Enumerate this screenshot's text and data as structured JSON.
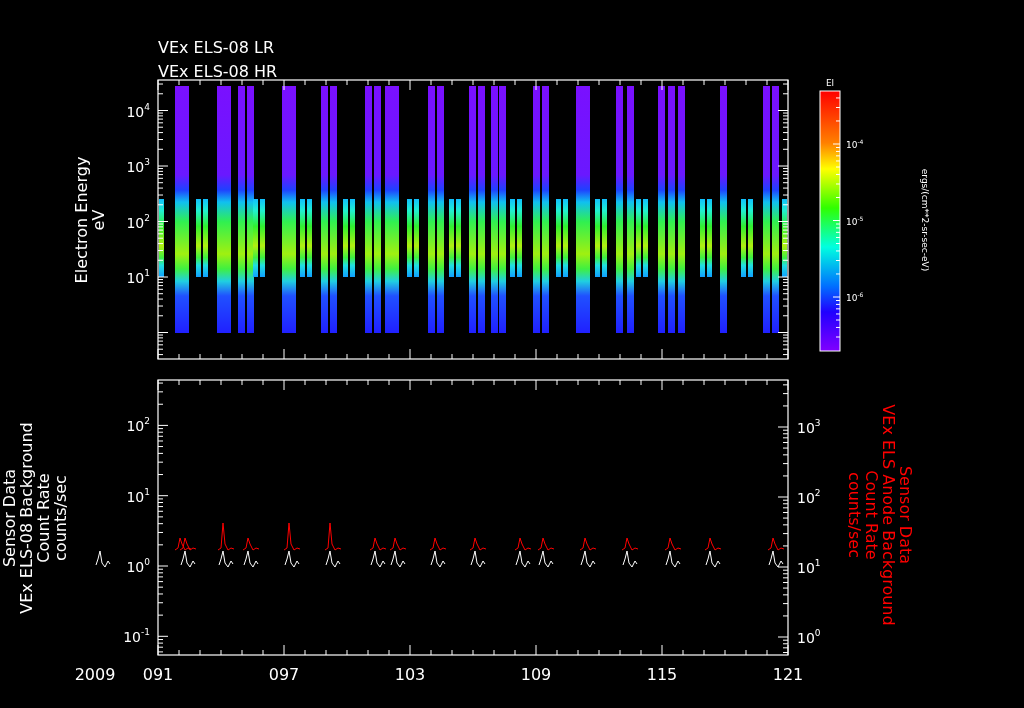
{
  "spectrogram_panel": {
    "title_lines": [
      "VEx ELS-08 LR",
      "VEx ELS-08 HR"
    ],
    "ylabel_lines": [
      "Electron Energy",
      "eV"
    ],
    "yticks": [
      {
        "base": "10",
        "exp": "4"
      },
      {
        "base": "10",
        "exp": "3"
      },
      {
        "base": "10",
        "exp": "2"
      },
      {
        "base": "10",
        "exp": "1"
      }
    ],
    "colorbar": {
      "title": "El",
      "unit": "ergs/(cm**2-sr-sec-eV)",
      "ticks": [
        {
          "base": "10",
          "exp": "-4"
        },
        {
          "base": "10",
          "exp": "-5"
        },
        {
          "base": "10",
          "exp": "-6"
        }
      ]
    }
  },
  "count_rate_panel": {
    "left_label_lines": [
      "Sensor Data",
      "VEx ELS-08 Background",
      "Count Rate",
      "counts/sec"
    ],
    "left_yticks": [
      {
        "base": "10",
        "exp": "2"
      },
      {
        "base": "10",
        "exp": "1"
      },
      {
        "base": "10",
        "exp": "0"
      },
      {
        "base": "10",
        "exp": "-1"
      }
    ],
    "right_label_lines": [
      "Sensor Data",
      "VEx ELS Anode Background",
      "Count Rate",
      "counts/sec"
    ],
    "right_yticks": [
      {
        "base": "10",
        "exp": "3"
      },
      {
        "base": "10",
        "exp": "2"
      },
      {
        "base": "10",
        "exp": "1"
      },
      {
        "base": "10",
        "exp": "0"
      }
    ]
  },
  "x_axis": {
    "year": "2009",
    "ticks": [
      "091",
      "097",
      "103",
      "109",
      "115",
      "121"
    ]
  }
}
